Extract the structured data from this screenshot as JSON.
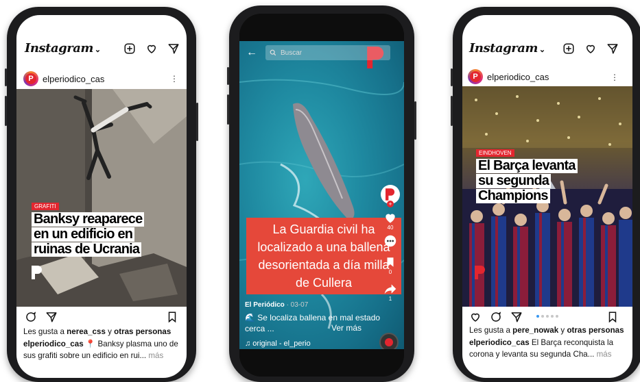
{
  "colors": {
    "accent_red": "#e3262f",
    "ig_blue": "#3897f0"
  },
  "instagram_app": {
    "logo": "Instagram",
    "chevron": "⌄"
  },
  "left_post": {
    "account": "elperiodico_cas",
    "avatar_letter": "P",
    "kicker": "GRAFITI",
    "headline_lines": [
      "Banksy reaparece",
      "en un edificio en",
      "ruinas de Ucrania"
    ],
    "likes_prefix": "Les gusta a ",
    "likes_user": "nerea_css",
    "likes_mid": " y ",
    "likes_others": "otras personas",
    "caption_user": "elperiodico_cas",
    "caption_text": " 📍 Banksy plasma uno de sus grafiti sobre un edificio en rui...",
    "caption_more": " más"
  },
  "video_post": {
    "search_placeholder": "Buscar",
    "title": "La Guardia civil ha localizado a una ballena desorientada a día milla de Cullera",
    "like_count": "40",
    "save_count": "0",
    "share_count": "1",
    "author": "El Periódico",
    "date": " · 03-07",
    "description": "🌊 Se localiza ballena en mal estado cerca ...",
    "more": "Ver más",
    "audio": "♫ original - el_perio"
  },
  "right_post": {
    "account": "elperiodico_cas",
    "avatar_letter": "P",
    "kicker": "EINDHOVEN",
    "headline_lines": [
      "El Barça levanta",
      "su segunda",
      "Champions"
    ],
    "likes_prefix": "Les gusta a ",
    "likes_user": "pere_nowak",
    "likes_mid": " y ",
    "likes_others": "otras personas",
    "caption_user": "elperiodico_cas",
    "caption_text": " El Barça reconquista la corona y levanta su segunda Cha...",
    "caption_more": " más",
    "carousel": {
      "count": 5,
      "active": 1
    }
  }
}
